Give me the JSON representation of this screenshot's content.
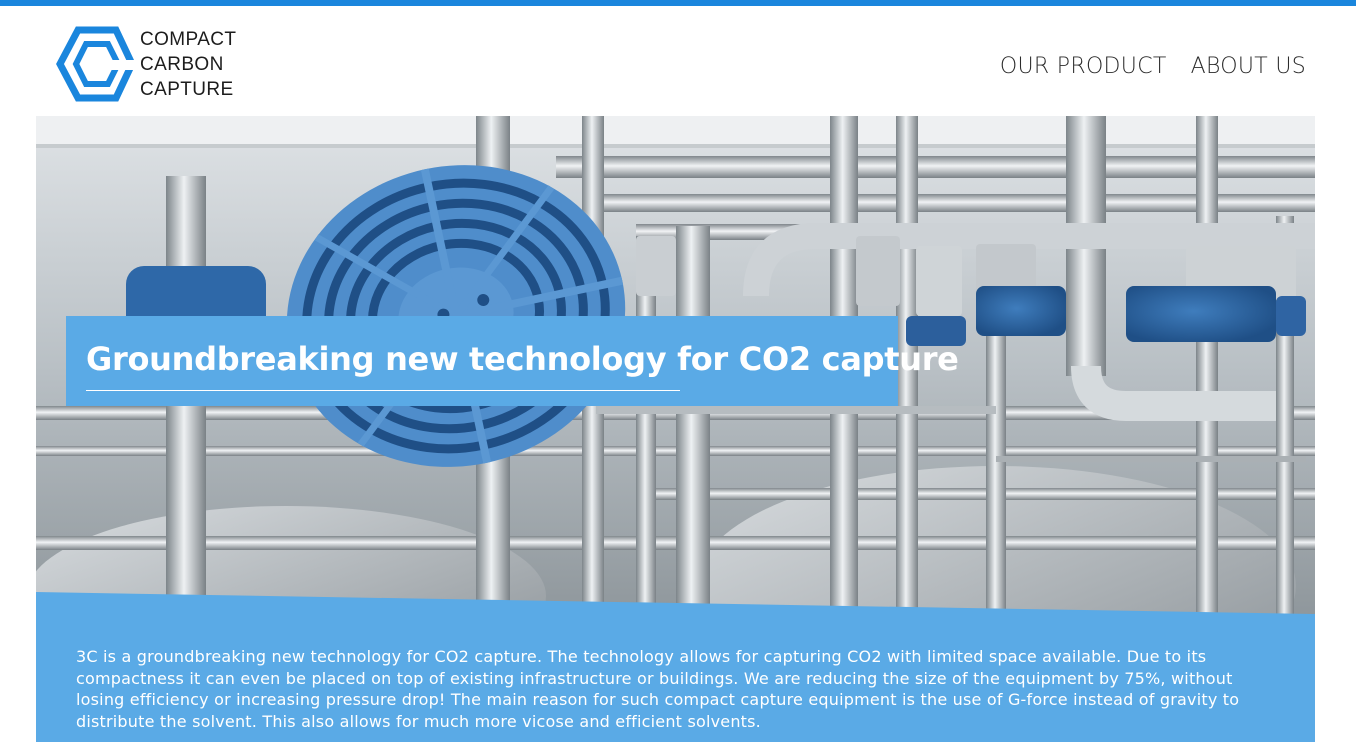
{
  "brand": {
    "line1": "COMPACT",
    "line2": "CARBON",
    "line3": "CAPTURE",
    "accent_color": "#1a86dd",
    "logo_icon": "hexagon-logo-icon"
  },
  "nav": {
    "items": [
      {
        "label": "OUR PRODUCT"
      },
      {
        "label": "ABOUT US"
      }
    ]
  },
  "hero": {
    "image": "industrial-pipes-photo",
    "headline": "Groundbreaking new technology for CO2 capture",
    "panel_color": "#5aaae6"
  },
  "description": {
    "text": "3C is a groundbreaking new technology for CO2 capture. The technology allows for capturing CO2 with limited space available. Due to its compactness it can even be placed on top of existing infrastructure or buildings. We are reducing the size of the equipment by 75%, without losing efficiency or increasing pressure drop! The main reason for such compact capture equipment is the use of G-force instead of gravity to distribute the solvent. This also allows for much more vicose and efficient solvents."
  }
}
